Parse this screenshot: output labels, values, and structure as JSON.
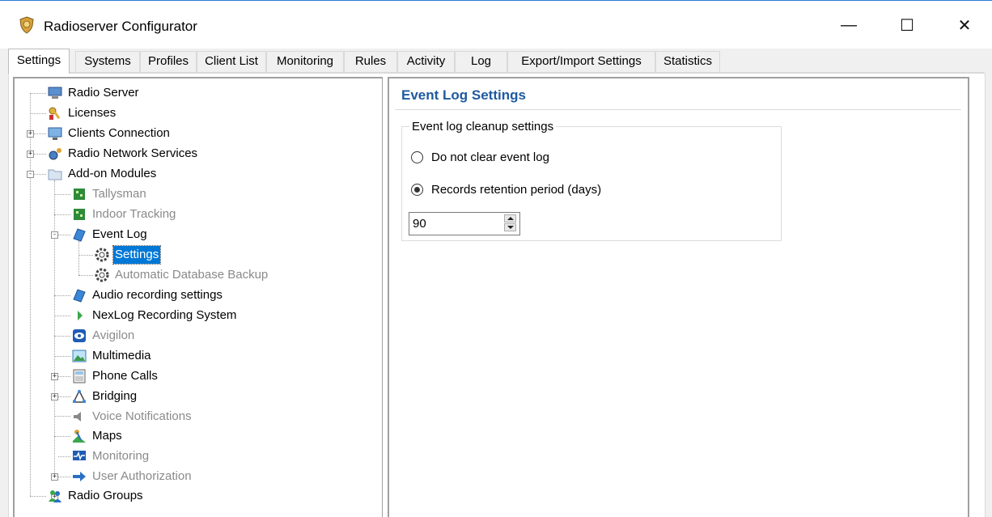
{
  "window": {
    "title": "Radioserver Configurator",
    "minimize_glyph": "—",
    "maximize_glyph": "☐",
    "close_glyph": "✕"
  },
  "tabs": [
    {
      "label": "Settings",
      "active": true
    },
    {
      "label": "Systems"
    },
    {
      "label": "Profiles"
    },
    {
      "label": "Client List"
    },
    {
      "label": "Monitoring"
    },
    {
      "label": "Rules"
    },
    {
      "label": "Activity"
    },
    {
      "label": "Log"
    },
    {
      "label": "Export/Import Settings"
    },
    {
      "label": "Statistics"
    }
  ],
  "tree": [
    {
      "label": "Radio Server",
      "icon": "server-icon"
    },
    {
      "label": "Licenses",
      "icon": "key-icon"
    },
    {
      "label": "Clients Connection",
      "icon": "monitor-network-icon",
      "expander": "+"
    },
    {
      "label": "Radio Network Services",
      "icon": "network-gear-icon",
      "expander": "+"
    },
    {
      "label": "Add-on Modules",
      "icon": "folder-icon",
      "expander": "-"
    },
    {
      "label": "Tallysman",
      "icon": "module-icon",
      "disabled": true
    },
    {
      "label": "Indoor Tracking",
      "icon": "module-icon",
      "disabled": true
    },
    {
      "label": "Event Log",
      "icon": "log-icon",
      "expander": "-"
    },
    {
      "label": "Settings",
      "icon": "gear-icon",
      "selected": true
    },
    {
      "label": "Automatic Database Backup",
      "icon": "gear-icon",
      "disabled": true
    },
    {
      "label": "Audio recording settings",
      "icon": "log-icon"
    },
    {
      "label": "NexLog Recording System",
      "icon": "play-arrow-icon"
    },
    {
      "label": "Avigilon",
      "icon": "eye-icon",
      "disabled": true
    },
    {
      "label": "Multimedia",
      "icon": "image-icon"
    },
    {
      "label": "Phone Calls",
      "icon": "phone-icon",
      "expander": "+"
    },
    {
      "label": "Bridging",
      "icon": "bridge-icon",
      "expander": "+"
    },
    {
      "label": "Voice Notifications",
      "icon": "speaker-icon",
      "disabled": true
    },
    {
      "label": "Maps",
      "icon": "map-icon"
    },
    {
      "label": "Monitoring",
      "icon": "monitoring-icon",
      "disabled": true,
      "expander": "+"
    },
    {
      "label": "User Authorization",
      "icon": "login-arrow-icon",
      "disabled": true,
      "expander": "+"
    },
    {
      "label": "Radio Groups",
      "icon": "users-icon"
    }
  ],
  "event_log_settings": {
    "heading": "Event Log Settings",
    "group_title": "Event log cleanup settings",
    "option_no_clear": "Do not clear event log",
    "option_retention": "Records retention period (days)",
    "selected_option": "retention",
    "retention_days": "90"
  },
  "colors": {
    "accent": "#0078d7",
    "heading": "#1e5aa0",
    "disabled_text": "#8a8a8a"
  }
}
